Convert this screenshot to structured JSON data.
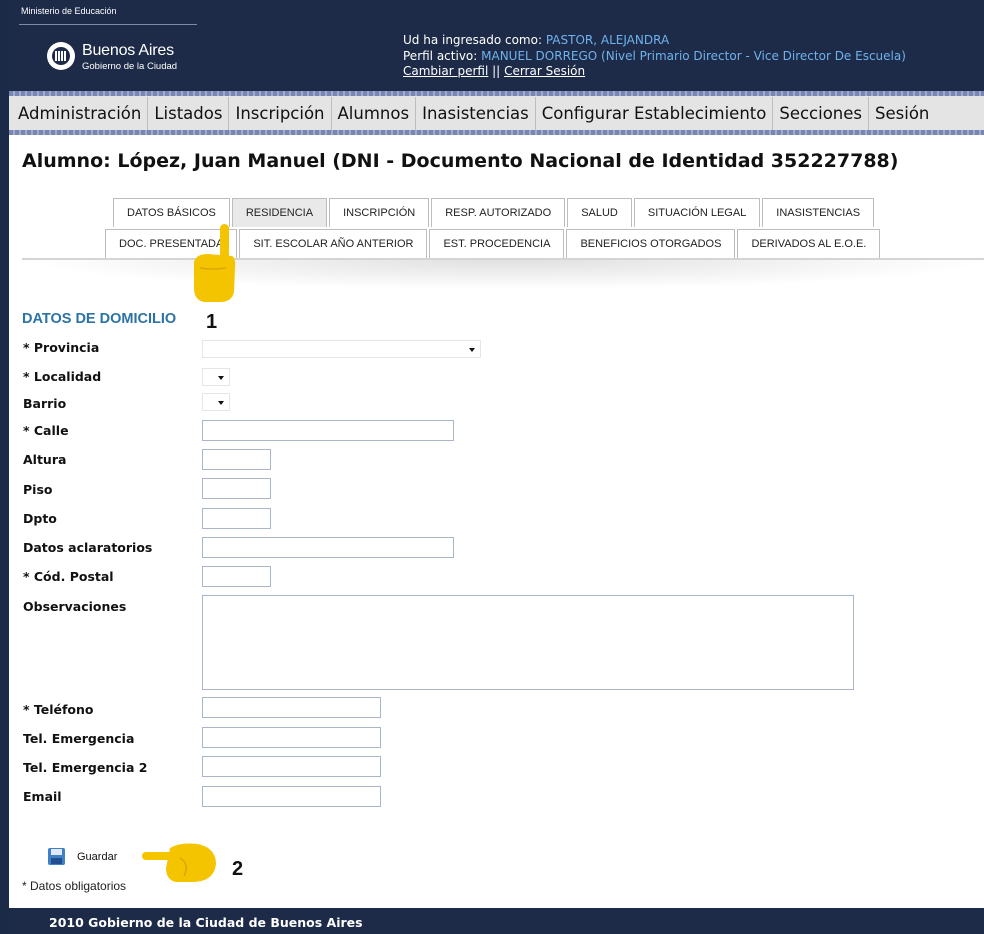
{
  "header": {
    "ministry": "Ministerio de Educación",
    "logo_title": "Buenos Aires",
    "logo_subtitle": "Gobierno de la Ciudad",
    "logged_in_label": "Ud ha ingresado como:",
    "logged_in_user": "PASTOR, ALEJANDRA",
    "profile_label": "Perfil activo:",
    "profile_value": "MANUEL DORREGO (Nivel Primario Director - Vice Director De Escuela)",
    "change_profile": "Cambiar perfil",
    "separator": "||",
    "logout": "Cerrar Sesión"
  },
  "menu": {
    "items": [
      "Administración",
      "Listados",
      "Inscripción",
      "Alumnos",
      "Inasistencias",
      "Configurar Establecimiento",
      "Secciones",
      "Sesión"
    ]
  },
  "page_title": "Alumno: López, Juan Manuel (DNI - Documento Nacional de Identidad 352227788)",
  "tabs": {
    "row1": [
      "DATOS BÁSICOS",
      "RESIDENCIA",
      "INSCRIPCIÓN",
      "RESP. AUTORIZADO",
      "SALUD",
      "SITUACIÓN LEGAL",
      "INASISTENCIAS"
    ],
    "row2": [
      "DOC. PRESENTADA",
      "SIT. ESCOLAR AÑO ANTERIOR",
      "EST. PROCEDENCIA",
      "BENEFICIOS OTORGADOS",
      "DERIVADOS AL E.O.E."
    ],
    "active": "RESIDENCIA"
  },
  "markers": {
    "one": "1",
    "two": "2"
  },
  "form": {
    "section_title": "DATOS DE DOMICILIO",
    "provincia": "* Provincia",
    "localidad": "* Localidad",
    "barrio": "Barrio",
    "calle": "* Calle",
    "altura": "Altura",
    "piso": "Piso",
    "dpto": "Dpto",
    "datos_aclaratorios": "Datos aclaratorios",
    "cod_postal": "* Cód. Postal",
    "observaciones": "Observaciones",
    "telefono": "* Teléfono",
    "tel_emergencia": "Tel. Emergencia",
    "tel_emergencia_2": "Tel. Emergencia 2",
    "email": "Email",
    "provincia_value": "",
    "localidad_value": "",
    "barrio_value": ""
  },
  "actions": {
    "save_label": "Guardar"
  },
  "required_note": "* Datos obligatorios",
  "footer": "2010 Gobierno de la Ciudad de Buenos Aires",
  "colors": {
    "header_bg": "#1d2b48",
    "highlight": "#6fb2ec",
    "section_title": "#2b73a6",
    "pointer": "#f5c400"
  }
}
